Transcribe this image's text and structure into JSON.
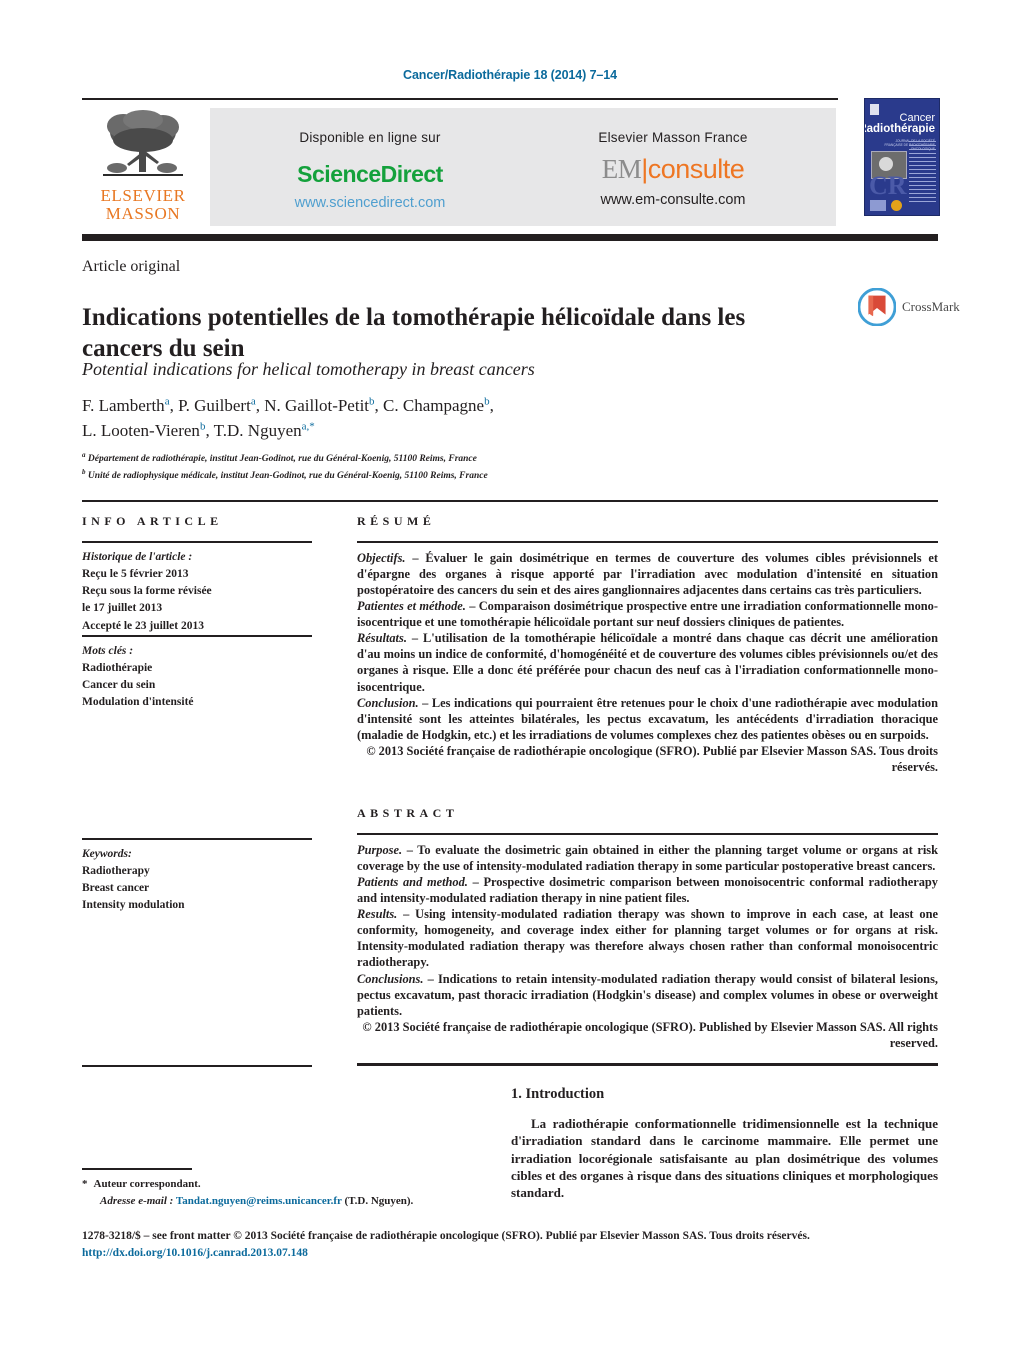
{
  "running_head": "Cancer/Radiothérapie 18 (2014) 7–14",
  "masthead": {
    "publisher_logo_line1": "ELSEVIER",
    "publisher_logo_line2": "MASSON",
    "left_caption": "Disponible en ligne sur",
    "sciencedirect_label": "ScienceDirect",
    "sciencedirect_url": "www.sciencedirect.com",
    "right_caption": "Elsevier Masson France",
    "em_consulte_em": "EM",
    "em_consulte_bar": "|",
    "em_consulte_word": "consulte",
    "em_consulte_url": "www.em-consulte.com",
    "cover": {
      "line1": "Cancer",
      "line2": "Radiothérapie",
      "subtitle": "JOURNAL DE LA SOCIÉTÉ FRANÇAISE DE RADIOTHÉRAPIE ONCOLOGIQUE",
      "monogram": "CR"
    },
    "colors": {
      "sciencedirect_green": "#14a13c",
      "sciencedirect_url_blue": "#4f9fcf",
      "em_orange": "#ee7623",
      "elsevier_orange": "#e87722",
      "running_head_blue": "#0b6a9c",
      "cover_blue": "#2a3a8c",
      "band_grey": "#e7e7e8"
    }
  },
  "article": {
    "type": "Article original",
    "title": "Indications potentielles de la tomothérapie hélicoïdale dans les cancers du sein",
    "subtitle": "Potential indications for helical tomotherapy in breast cancers",
    "authors_line1": "F. Lamberth",
    "authors": [
      {
        "name": "F. Lamberth",
        "marks": "a"
      },
      {
        "name": "P. Guilbert",
        "marks": "a"
      },
      {
        "name": "N. Gaillot-Petit",
        "marks": "b"
      },
      {
        "name": "C. Champagne",
        "marks": "b"
      },
      {
        "name": "L. Looten-Vieren",
        "marks": "b"
      },
      {
        "name": "T.D. Nguyen",
        "marks": "a,*"
      }
    ],
    "affiliations": [
      {
        "mark": "a",
        "text": "Département de radiothérapie, institut Jean-Godinot, rue du Général-Koenig, 51100 Reims, France"
      },
      {
        "mark": "b",
        "text": "Unité de radiophysique médicale, institut Jean-Godinot, rue du Général-Koenig, 51100 Reims, France"
      }
    ],
    "crossmark_label": "CrossMark"
  },
  "info_article": {
    "heading": "INFO ARTICLE",
    "history_title": "Historique de l'article :",
    "history": [
      "Reçu le 5 février 2013",
      "Reçu sous la forme révisée",
      "le 17 juillet 2013",
      "Accepté le 23 juillet 2013"
    ],
    "keywords_fr_title": "Mots clés :",
    "keywords_fr": [
      "Radiothérapie",
      "Cancer du sein",
      "Modulation d'intensité"
    ],
    "keywords_en_title": "Keywords:",
    "keywords_en": [
      "Radiotherapy",
      "Breast cancer",
      "Intensity modulation"
    ]
  },
  "resume": {
    "heading": "RÉSUMÉ",
    "paragraphs": [
      {
        "lead": "Objectifs.",
        "text": " – Évaluer le gain dosimétrique en termes de couverture des volumes cibles prévisionnels et d'épargne des organes à risque apporté par l'irradiation avec modulation d'intensité en situation postopératoire des cancers du sein et des aires ganglionnaires adjacentes dans certains cas très particuliers."
      },
      {
        "lead": "Patientes et méthode.",
        "text": " – Comparaison dosimétrique prospective entre une irradiation conformationnelle mono-isocentrique et une tomothérapie hélicoïdale portant sur neuf dossiers cliniques de patientes."
      },
      {
        "lead": "Résultats.",
        "text": " – L'utilisation de la tomothérapie hélicoïdale a montré dans chaque cas décrit une amélioration d'au moins un indice de conformité, d'homogénéité et de couverture des volumes cibles prévisionnels ou/et des organes à risque. Elle a donc été préférée pour chacun des neuf cas à l'irradiation conformationnelle mono-isocentrique."
      },
      {
        "lead": "Conclusion.",
        "text": " – Les indications qui pourraient être retenues pour le choix d'une radiothérapie avec modulation d'intensité sont les atteintes bilatérales, les pectus excavatum, les antécédents d'irradiation thoracique (maladie de Hodgkin, etc.) et les irradiations de volumes complexes chez des patientes obèses ou en surpoids."
      }
    ],
    "copyright": "© 2013 Société française de radiothérapie oncologique (SFRO). Publié par Elsevier Masson SAS. Tous droits réservés."
  },
  "abstract": {
    "heading": "ABSTRACT",
    "paragraphs": [
      {
        "lead": "Purpose.",
        "text": " – To evaluate the dosimetric gain obtained in either the planning target volume or organs at risk coverage by the use of intensity-modulated radiation therapy in some particular postoperative breast cancers."
      },
      {
        "lead": "Patients and method.",
        "text": " – Prospective dosimetric comparison between monoisocentric conformal radiotherapy and intensity-modulated radiation therapy in nine patient files."
      },
      {
        "lead": "Results.",
        "text": " – Using intensity-modulated radiation therapy was shown to improve in each case, at least one conformity, homogeneity, and coverage index either for planning target volumes or for organs at risk. Intensity-modulated radiation therapy was therefore always chosen rather than conformal monoisocentric radiotherapy."
      },
      {
        "lead": "Conclusions.",
        "text": " – Indications to retain intensity-modulated radiation therapy would consist of bilateral lesions, pectus excavatum, past thoracic irradiation (Hodgkin's disease) and complex volumes in obese or overweight patients."
      }
    ],
    "copyright": "© 2013 Société française de radiothérapie oncologique (SFRO). Published by Elsevier Masson SAS. All rights reserved."
  },
  "introduction": {
    "heading": "1. Introduction",
    "paragraph": "La radiothérapie conformationnelle tridimensionnelle est la technique d'irradiation standard dans le carcinome mammaire. Elle permet une irradiation locorégionale satisfaisante au plan dosimétrique des volumes cibles et des organes à risque dans des situations cliniques et morphologiques standard."
  },
  "footnote": {
    "star": "*",
    "line1": "Auteur correspondant.",
    "email_label": "Adresse e-mail :",
    "email": "Tandat.nguyen@reims.unicancer.fr",
    "email_suffix": "(T.D. Nguyen)."
  },
  "imprint": {
    "line1": "1278-3218/$ – see front matter © 2013 Société française de radiothérapie oncologique (SFRO). Publié par Elsevier Masson SAS. Tous droits réservés.",
    "doi": "http://dx.doi.org/10.1016/j.canrad.2013.07.148"
  }
}
